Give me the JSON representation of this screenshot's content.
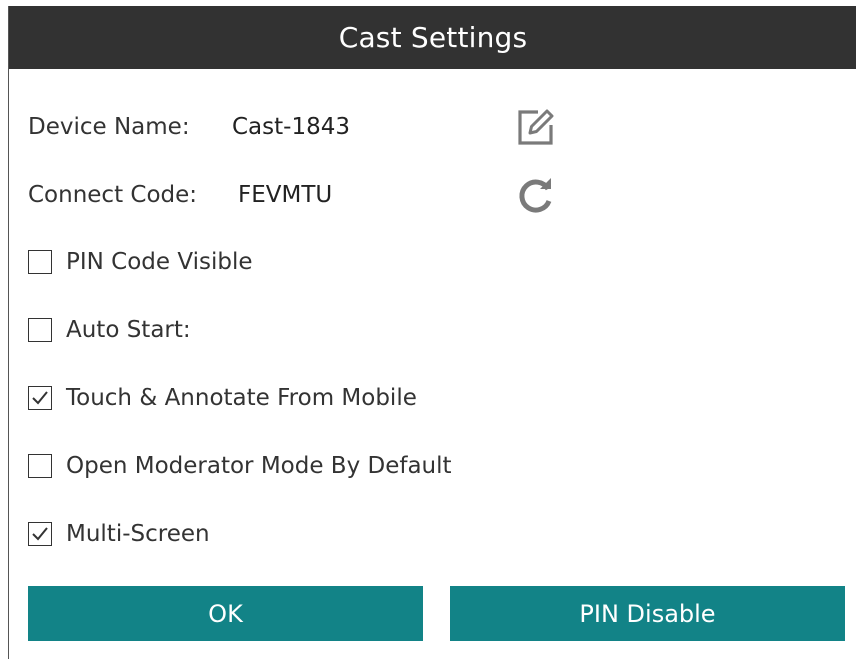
{
  "dialog": {
    "title": "Cast Settings"
  },
  "device": {
    "label": "Device Name:",
    "value": "Cast-1843",
    "edit_icon": "edit-icon"
  },
  "connect": {
    "label": "Connect Code:",
    "value": "FEVMTU",
    "refresh_icon": "refresh-icon"
  },
  "options": [
    {
      "label": "PIN Code Visible",
      "checked": false
    },
    {
      "label": "Auto Start:",
      "checked": false
    },
    {
      "label": "Touch & Annotate From Mobile",
      "checked": true
    },
    {
      "label": "Open Moderator Mode By Default",
      "checked": false
    },
    {
      "label": "Multi-Screen",
      "checked": true
    }
  ],
  "buttons": {
    "ok": "OK",
    "pin_disable": "PIN Disable"
  },
  "colors": {
    "titlebar": "#323232",
    "accent": "#128387",
    "icon": "#7a7a7a"
  }
}
